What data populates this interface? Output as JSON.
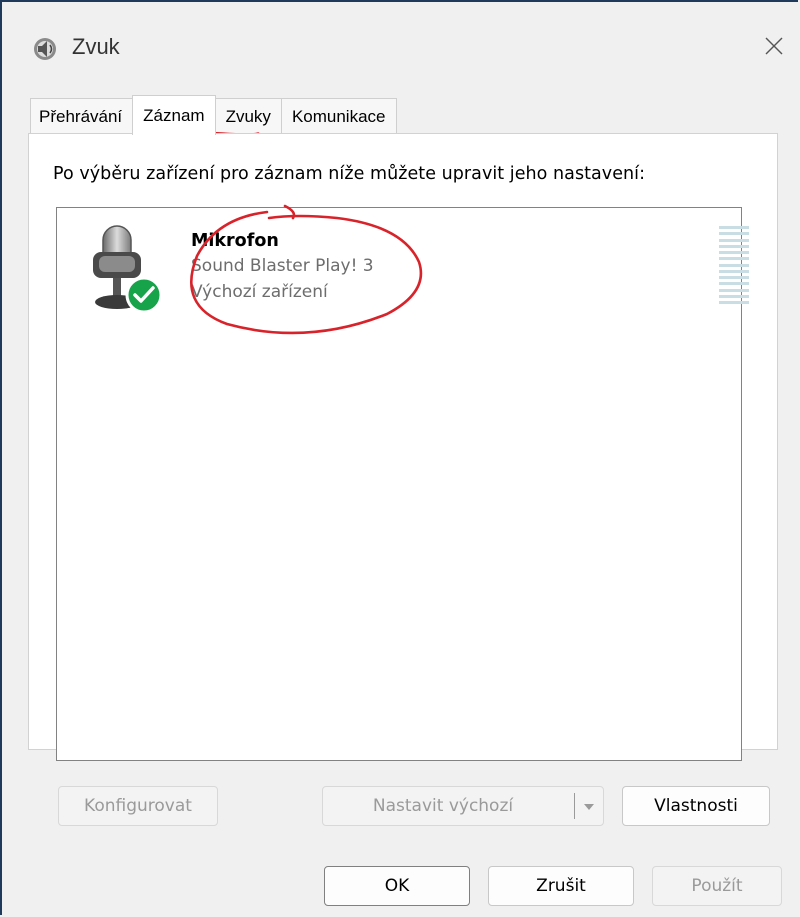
{
  "window": {
    "title": "Zvuk",
    "close_glyph": "✕"
  },
  "tabs": [
    {
      "label": "Přehrávání",
      "active": false
    },
    {
      "label": "Záznam",
      "active": true
    },
    {
      "label": "Zvuky",
      "active": false
    },
    {
      "label": "Komunikace",
      "active": false
    }
  ],
  "panel": {
    "instruction": "Po výběru zařízení pro záznam níže můžete upravit jeho nastavení:"
  },
  "devices": [
    {
      "name": "Mikrofon",
      "description": "Sound Blaster Play! 3",
      "status": "Výchozí zařízení",
      "icon": "microphone-icon",
      "badge_icon": "checkmark-icon"
    }
  ],
  "panel_buttons": {
    "configure": "Konfigurovat",
    "set_default": "Nastavit výchozí",
    "properties": "Vlastnosti"
  },
  "dialog_buttons": {
    "ok": "OK",
    "cancel": "Zrušit",
    "apply": "Použít"
  },
  "colors": {
    "accent_annotation": "#d8232a",
    "default_badge": "#17a34a",
    "level_meter": "#c9dde5"
  }
}
